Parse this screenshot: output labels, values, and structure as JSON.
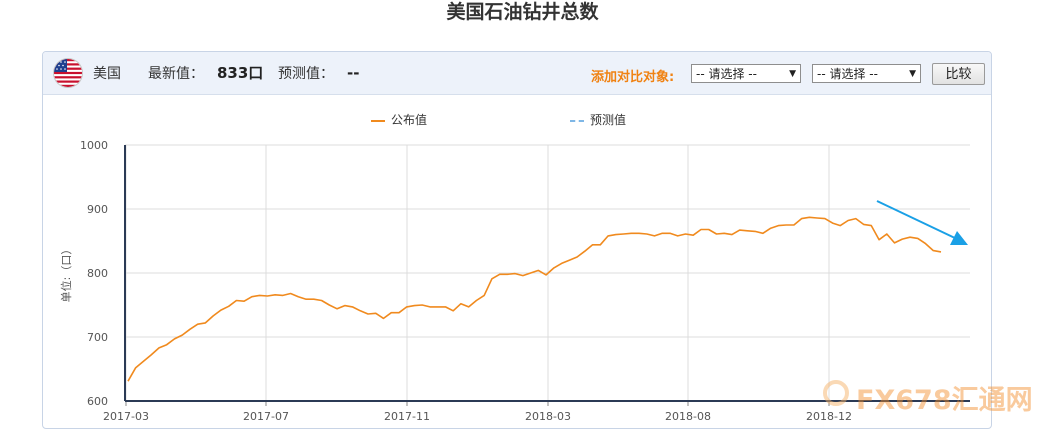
{
  "title": "美国石油钻井总数",
  "toolbar": {
    "country": "美国",
    "latest_label": "最新值：",
    "latest_value": "833口",
    "forecast_label": "预测值：",
    "forecast_value": "--",
    "compare_label": "添加对比对象:",
    "select1": "-- 请选择 --",
    "select2": "-- 请选择 --",
    "compare_button": "比较"
  },
  "colors": {
    "series": "#f08a1e",
    "forecast": "#7fb7e6",
    "arrow": "#1aa0e6"
  },
  "watermark": "FX678汇通网",
  "chart_data": {
    "type": "line",
    "ylabel": "单位:（口）",
    "ylim": [
      600,
      1000
    ],
    "yticks": [
      "1000",
      "900",
      "800",
      "700",
      "600"
    ],
    "xticks": [
      "2017-03",
      "2017-07",
      "2017-11",
      "2018-03",
      "2018-08",
      "2018-12"
    ],
    "grid": true,
    "legend": [
      "公布值",
      "预测值"
    ],
    "series": [
      {
        "name": "公布值",
        "values": [
          631,
          652,
          662,
          672,
          683,
          688,
          697,
          703,
          712,
          720,
          722,
          733,
          742,
          748,
          757,
          756,
          763,
          765,
          764,
          766,
          765,
          768,
          763,
          759,
          759,
          757,
          750,
          744,
          749,
          747,
          741,
          736,
          737,
          729,
          738,
          738,
          747,
          749,
          750,
          747,
          747,
          747,
          741,
          752,
          747,
          757,
          765,
          791,
          798,
          798,
          799,
          796,
          800,
          804,
          797,
          808,
          815,
          820,
          825,
          834,
          844,
          844,
          858,
          860,
          861,
          862,
          862,
          861,
          858,
          862,
          862,
          858,
          861,
          859,
          868,
          868,
          861,
          862,
          860,
          867,
          866,
          865,
          862,
          870,
          874,
          875,
          875,
          885,
          887,
          886,
          885,
          878,
          874,
          882,
          885,
          876,
          874,
          852,
          861,
          847,
          853,
          856,
          854,
          846,
          835,
          833
        ]
      },
      {
        "name": "预测值",
        "values": []
      }
    ]
  }
}
